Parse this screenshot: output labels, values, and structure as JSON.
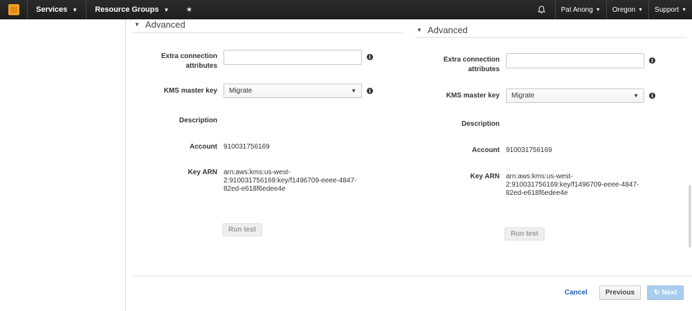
{
  "nav": {
    "services": "Services",
    "resource_groups": "Resource Groups",
    "user": "Pat Anong",
    "region": "Oregon",
    "support": "Support",
    "icons": {
      "logo": "aws-cube-icon",
      "pin": "pin-icon",
      "bell": "bell-icon"
    }
  },
  "left": {
    "advanced": "Advanced",
    "extra_label": "Extra connection attributes",
    "extra_value": "",
    "kms_label": "KMS master key",
    "kms_value": "Migrate",
    "desc_label": "Description",
    "account_label": "Account",
    "account_value": "910031756169",
    "arn_label": "Key ARN",
    "arn_line1": "arn:aws:kms:us-west-",
    "arn_line2": "2:910031756169:key/f1496709-eeee-4847-",
    "arn_line3": "82ed-e618f6edee4e",
    "run_test": "Run test"
  },
  "right": {
    "advanced": "Advanced",
    "extra_label": "Extra connection attributes",
    "extra_value": "",
    "kms_label": "KMS master key",
    "kms_value": "Migrate",
    "desc_label": "Description",
    "account_label": "Account",
    "account_value": "910031756169",
    "arn_label": "Key ARN",
    "arn_line1": "arn:aws:kms:us-west-",
    "arn_line2": "2:910031756169:key/f1496709-eeee-4847-",
    "arn_line3": "82ed-e618f6edee4e",
    "run_test": "Run test"
  },
  "footer": {
    "cancel": "Cancel",
    "previous": "Previous",
    "next": "Next"
  }
}
